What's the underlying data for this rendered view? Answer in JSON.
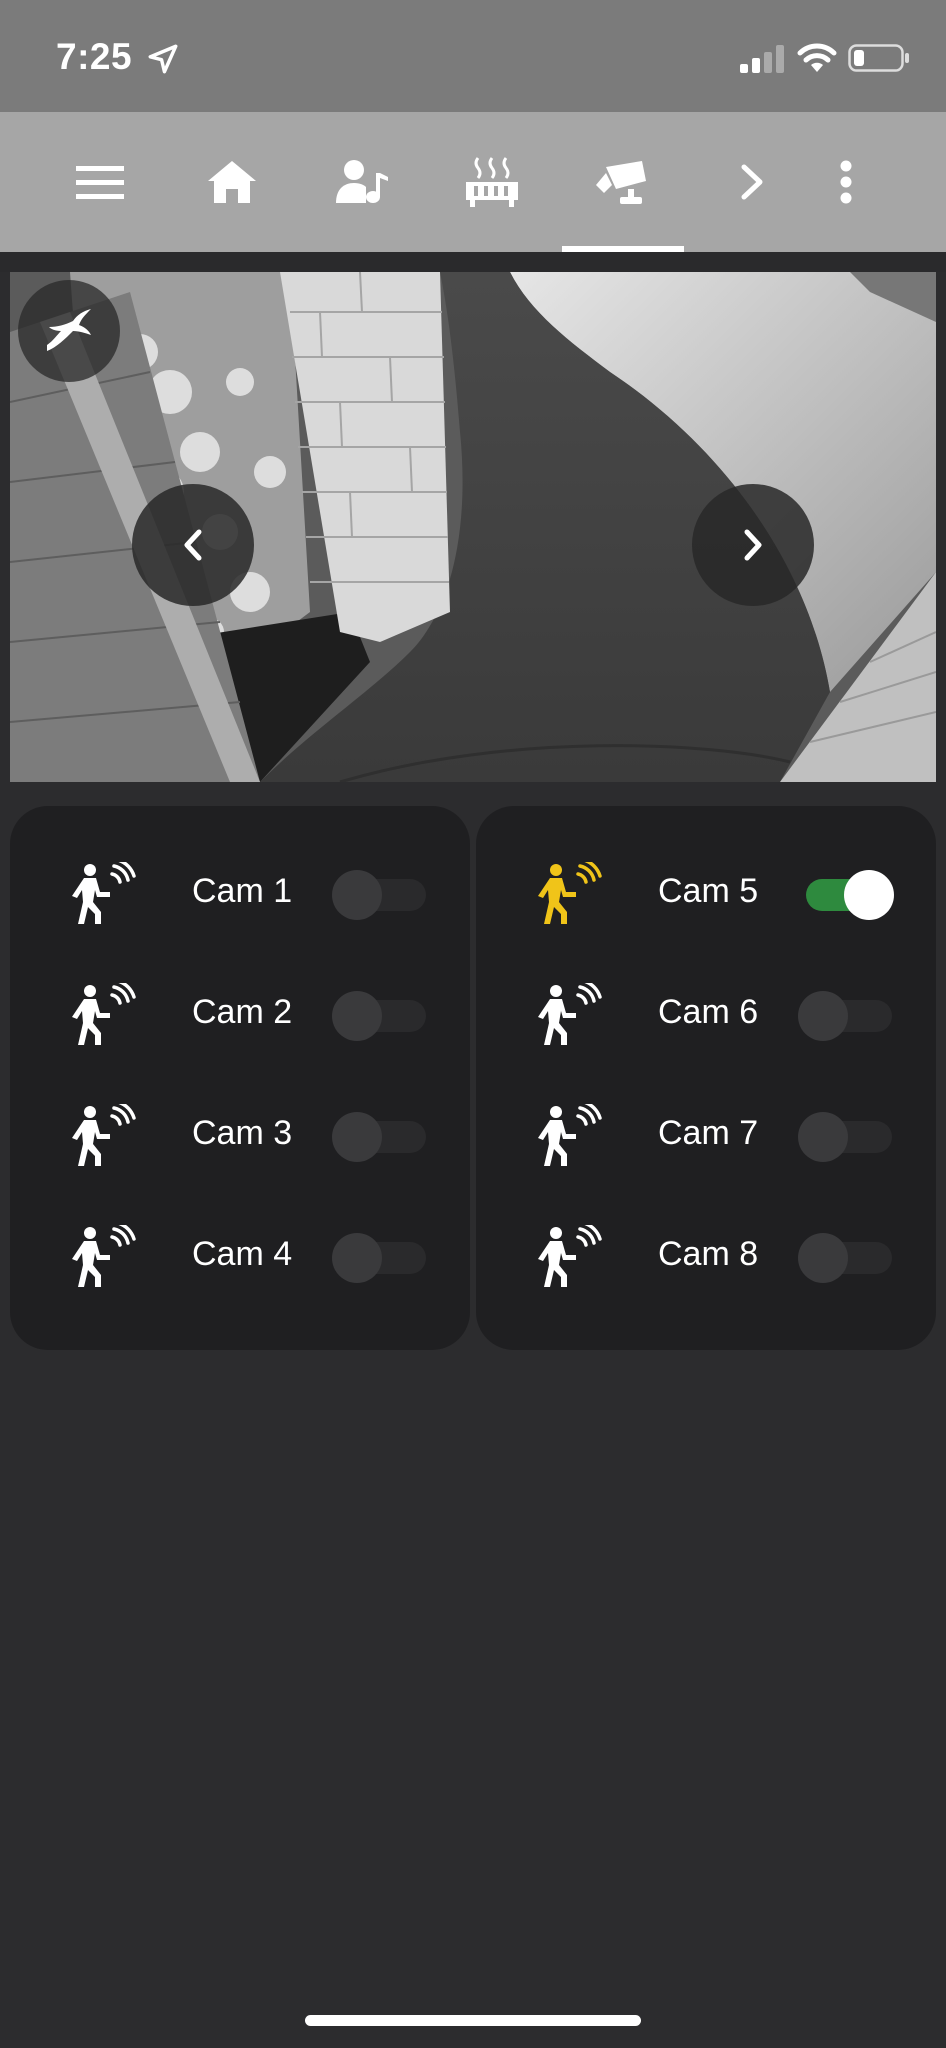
{
  "status_bar": {
    "time": "7:25",
    "icons": [
      "location-arrow-icon",
      "cellular-signal-icon",
      "wifi-icon",
      "battery-icon"
    ]
  },
  "toolbar": {
    "items": [
      {
        "name": "menu-icon"
      },
      {
        "name": "home-icon"
      },
      {
        "name": "user-music-icon"
      },
      {
        "name": "radiator-icon"
      },
      {
        "name": "security-camera-icon",
        "selected": true
      },
      {
        "name": "chevron-right-icon"
      },
      {
        "name": "more-vertical-icon"
      }
    ]
  },
  "camera_view": {
    "controls": [
      "logo-icon",
      "chevron-left-icon",
      "chevron-right-icon"
    ]
  },
  "cameras": [
    {
      "label": "Cam 1",
      "on": false,
      "motion": false
    },
    {
      "label": "Cam 2",
      "on": false,
      "motion": false
    },
    {
      "label": "Cam 3",
      "on": false,
      "motion": false
    },
    {
      "label": "Cam 4",
      "on": false,
      "motion": false
    },
    {
      "label": "Cam 5",
      "on": true,
      "motion": true
    },
    {
      "label": "Cam 6",
      "on": false,
      "motion": false
    },
    {
      "label": "Cam 7",
      "on": false,
      "motion": false
    },
    {
      "label": "Cam 8",
      "on": false,
      "motion": false
    }
  ],
  "colors": {
    "background": "#2c2c2e",
    "status_bar": "#7b7b7b",
    "toolbar": "#a6a6a6",
    "panel": "#1f1f21",
    "toggle_on": "#2e8a3e",
    "motion_active": "#f0c419",
    "motion_idle": "#ffffff"
  }
}
